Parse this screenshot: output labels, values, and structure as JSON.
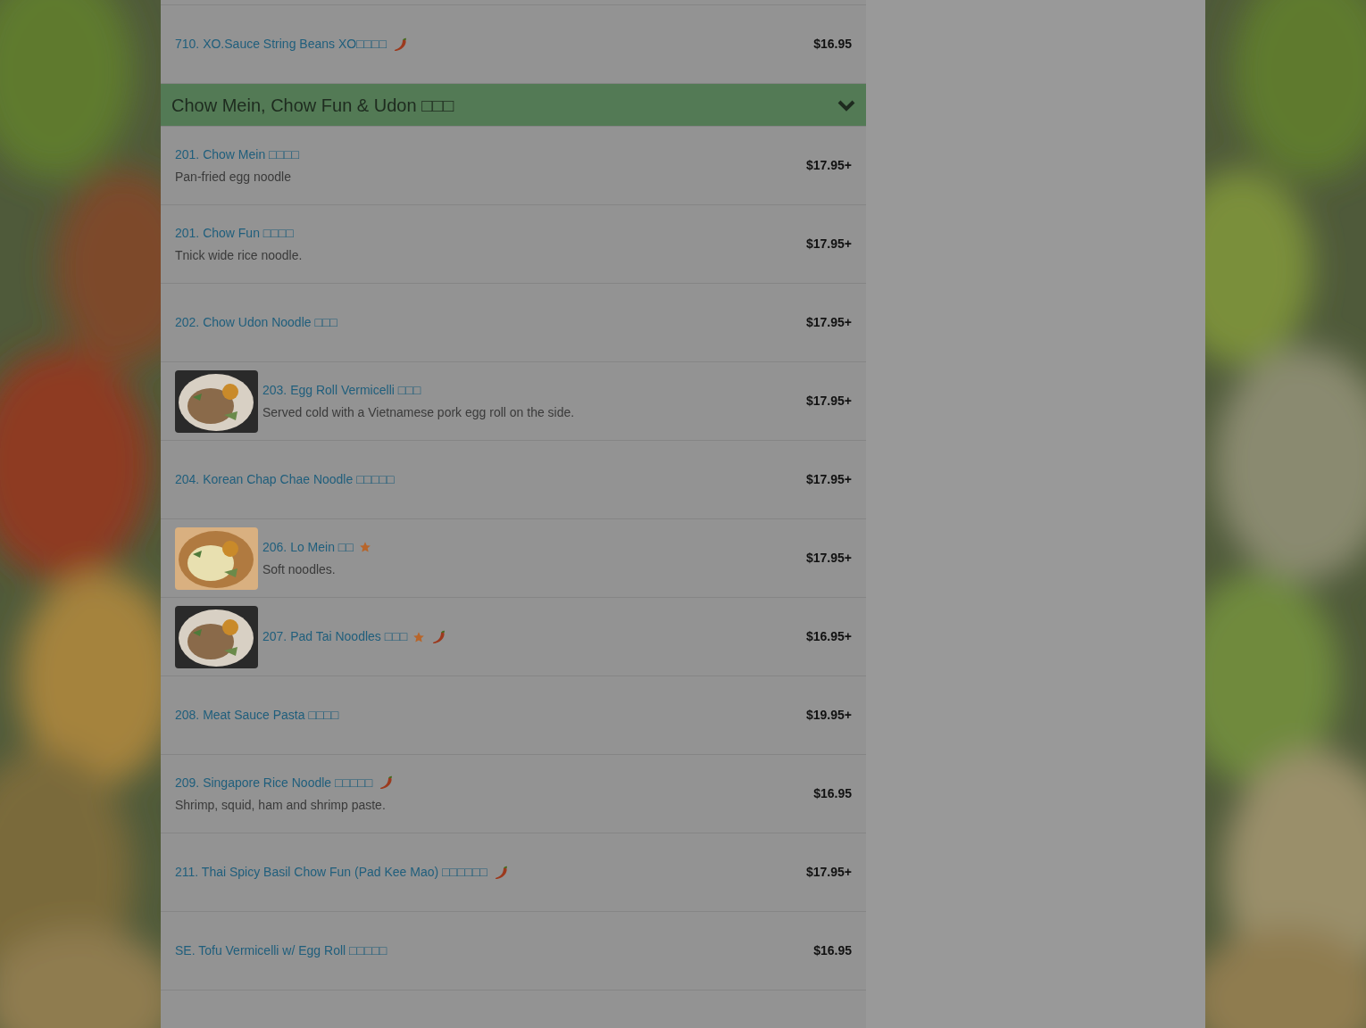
{
  "top_items": [
    {
      "name": "710. XO.Sauce String Beans XO□□□□",
      "price": "$16.95",
      "has_photo": false,
      "starred": false,
      "spicy": true
    }
  ],
  "section": {
    "title": "Chow Mein, Chow Fun & Udon □□□",
    "expanded": true,
    "items": [
      {
        "name": "201. Chow Mein □□□□",
        "description": "Pan-fried egg noodle",
        "price": "$17.95+",
        "has_photo": false,
        "starred": false,
        "spicy": false
      },
      {
        "name": "201. Chow Fun □□□□",
        "description": "Tnick wide rice noodle.",
        "price": "$17.95+",
        "has_photo": false,
        "starred": false,
        "spicy": false
      },
      {
        "name": "202. Chow Udon Noodle □□□",
        "price": "$17.95+",
        "has_photo": false,
        "starred": false,
        "spicy": false
      },
      {
        "name": "203. Egg Roll Vermicelli □□□",
        "description": "Served cold with a Vietnamese pork egg roll on the side.",
        "price": "$17.95+",
        "has_photo": true,
        "starred": false,
        "spicy": false
      },
      {
        "name": "204. Korean Chap Chae Noodle □□□□□",
        "price": "$17.95+",
        "has_photo": false,
        "starred": false,
        "spicy": false
      },
      {
        "name": "206. Lo Mein □□",
        "description": "Soft noodles.",
        "price": "$17.95+",
        "has_photo": true,
        "starred": true,
        "spicy": false
      },
      {
        "name": "207. Pad Tai Noodles □□□",
        "price": "$16.95+",
        "has_photo": true,
        "starred": true,
        "spicy": true
      },
      {
        "name": "208. Meat Sauce Pasta □□□□",
        "price": "$19.95+",
        "has_photo": false,
        "starred": false,
        "spicy": false
      },
      {
        "name": "209. Singapore Rice Noodle □□□□□",
        "description": "Shrimp, squid, ham and shrimp paste.",
        "price": "$16.95",
        "has_photo": false,
        "starred": false,
        "spicy": true
      },
      {
        "name": "211. Thai Spicy Basil Chow Fun (Pad Kee Mao) □□□□□□",
        "price": "$17.95+",
        "has_photo": false,
        "starred": false,
        "spicy": true
      },
      {
        "name": "SE. Tofu Vermicelli w/ Egg Roll □□□□□",
        "price": "$16.95",
        "has_photo": false,
        "starred": false,
        "spicy": false
      }
    ]
  }
}
